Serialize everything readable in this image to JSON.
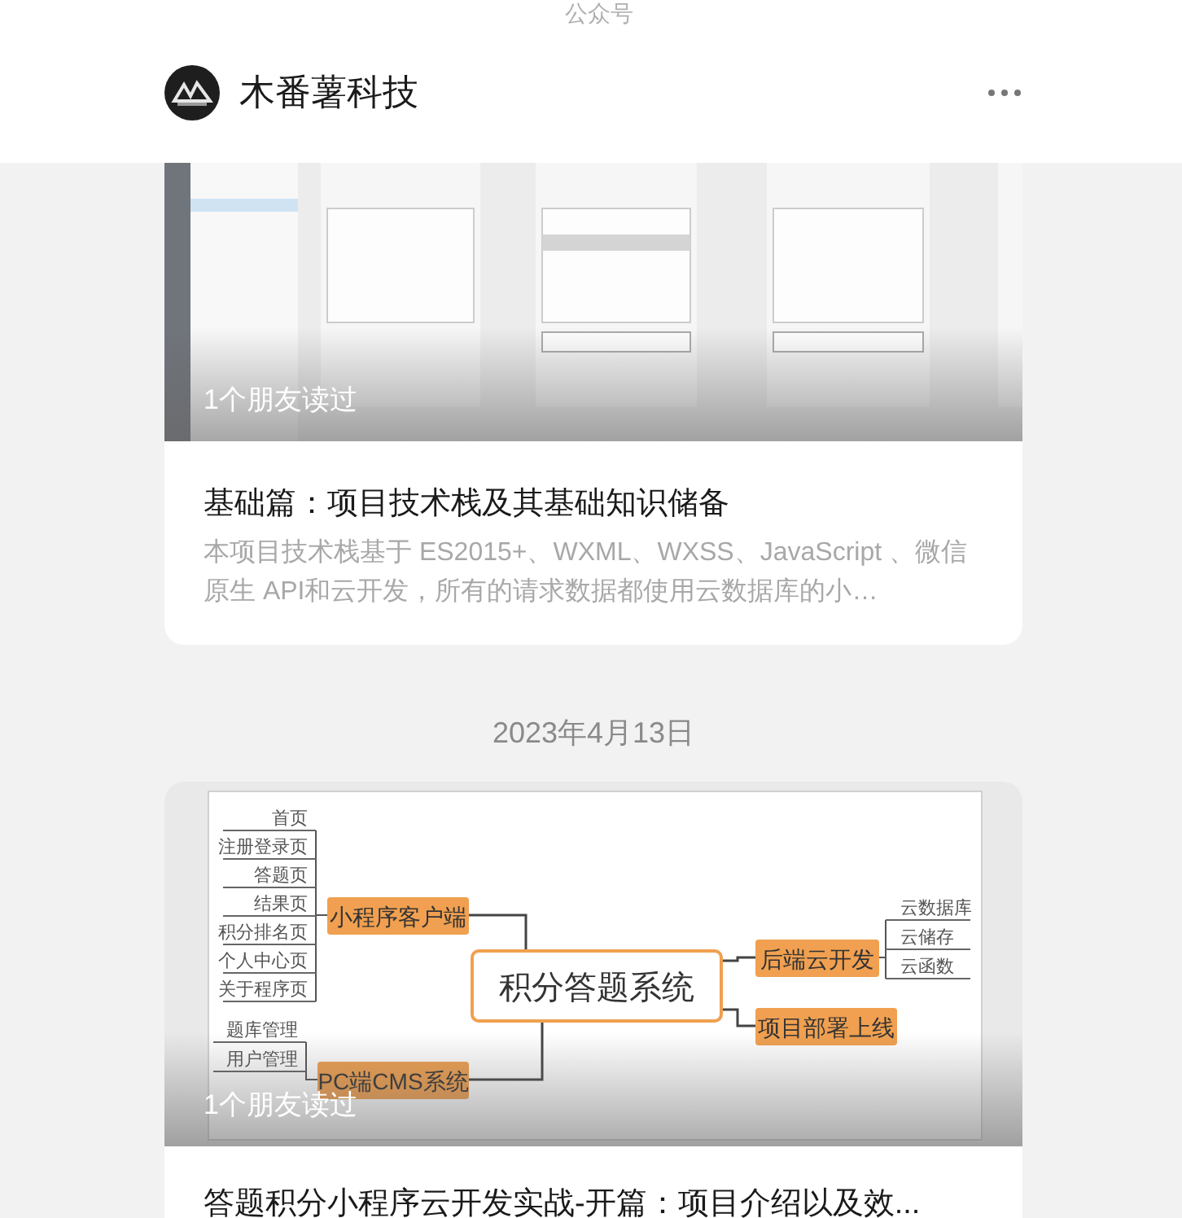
{
  "top_label": "公众号",
  "account": {
    "name": "木番薯科技"
  },
  "feed": [
    {
      "kind": "article",
      "friends_read": "1个朋友读过",
      "title": "基础篇：项目技术栈及其基础知识储备",
      "summary": "本项目技术栈基于 ES2015+、WXML、WXSS、JavaScript 、微信原生 API和云开发，所有的请求数据都使用云数据库的小…"
    },
    {
      "kind": "date",
      "text": "2023年4月13日"
    },
    {
      "kind": "article",
      "cover": {
        "kind": "mindmap",
        "center": "积分答题系统",
        "branches": [
          {
            "label": "小程序客户端",
            "children": [
              "首页",
              "注册登录页",
              "答题页",
              "结果页",
              "积分排名页",
              "个人中心页",
              "关于程序页"
            ]
          },
          {
            "label": "PC端CMS系统",
            "children": [
              "题库管理",
              "用户管理"
            ]
          },
          {
            "label": "后端云开发",
            "children": [
              "云数据库",
              "云储存",
              "云函数"
            ]
          },
          {
            "label": "项目部署上线"
          }
        ]
      },
      "friends_read": "1个朋友读过",
      "title": "答题积分小程序云开发实战-开篇：项目介绍以及效..."
    }
  ]
}
